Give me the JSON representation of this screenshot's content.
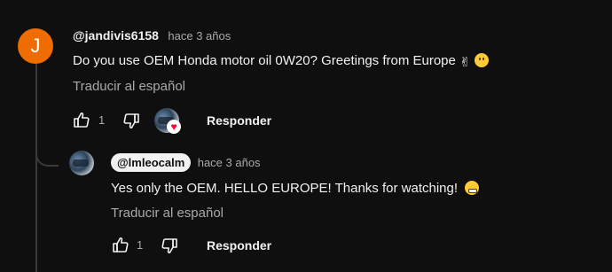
{
  "comment": {
    "author": "@jandivis6158",
    "time": "hace 3 años",
    "avatar_letter": "J",
    "avatar_color": "#ef6c00",
    "text": "Do you use OEM Honda motor oil 0W20? Greetings from Europe",
    "emojis": [
      "victory-hand",
      "smiling-face"
    ],
    "translate_label": "Traducir al español",
    "like_count": "1",
    "reply_label": "Responder",
    "creator_heart": true
  },
  "reply": {
    "author": "@lmleocalm",
    "time": "hace 3 años",
    "text": "Yes only the OEM. HELLO EUROPE! Thanks for watching!",
    "emojis": [
      "grinning-face"
    ],
    "translate_label": "Traducir al español",
    "like_count": "1",
    "reply_label": "Responder"
  }
}
